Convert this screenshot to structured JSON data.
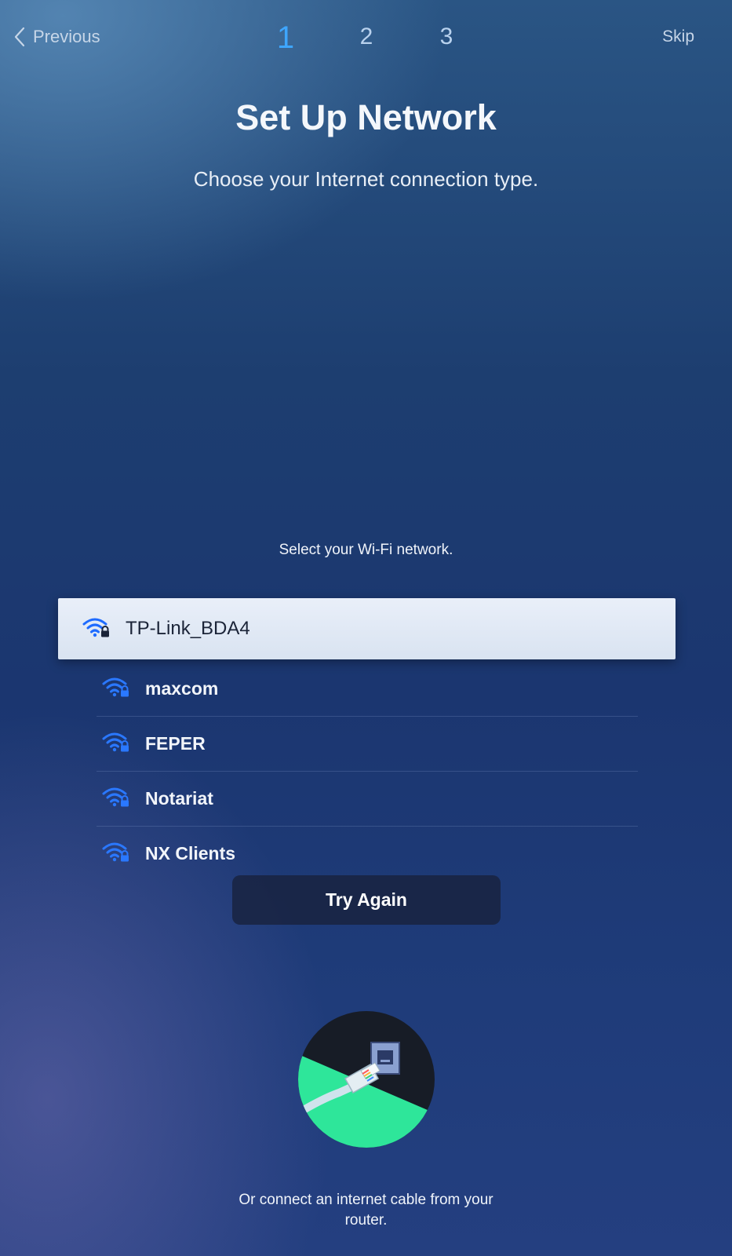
{
  "nav": {
    "previous_label": "Previous",
    "skip_label": "Skip",
    "steps": [
      "1",
      "2",
      "3"
    ],
    "active_step": 1
  },
  "header": {
    "title": "Set Up Network",
    "subtitle": "Choose your Internet connection type."
  },
  "wifi": {
    "prompt": "Select your Wi-Fi network.",
    "networks": [
      {
        "name": "TP-Link_BDA4",
        "secured": true,
        "selected": true
      },
      {
        "name": "maxcom",
        "secured": true,
        "selected": false
      },
      {
        "name": "FEPER",
        "secured": true,
        "selected": false
      },
      {
        "name": "Notariat",
        "secured": true,
        "selected": false
      },
      {
        "name": "NX Clients",
        "secured": true,
        "selected": false
      }
    ],
    "try_again_label": "Try Again"
  },
  "cable": {
    "text_line1": "Or connect an internet cable from your",
    "text_line2": "router."
  },
  "colors": {
    "accent": "#3ea6ff",
    "wifi_icon": "#1e6bff",
    "selected_row_bg": "#e4ebf6",
    "button_bg": "#18223e",
    "illustration_green": "#2ee69a",
    "illustration_dark": "#171c26"
  },
  "icons": {
    "back": "chevron-left-icon",
    "wifi": "wifi-lock-icon",
    "cable": "ethernet-cable-illustration"
  }
}
